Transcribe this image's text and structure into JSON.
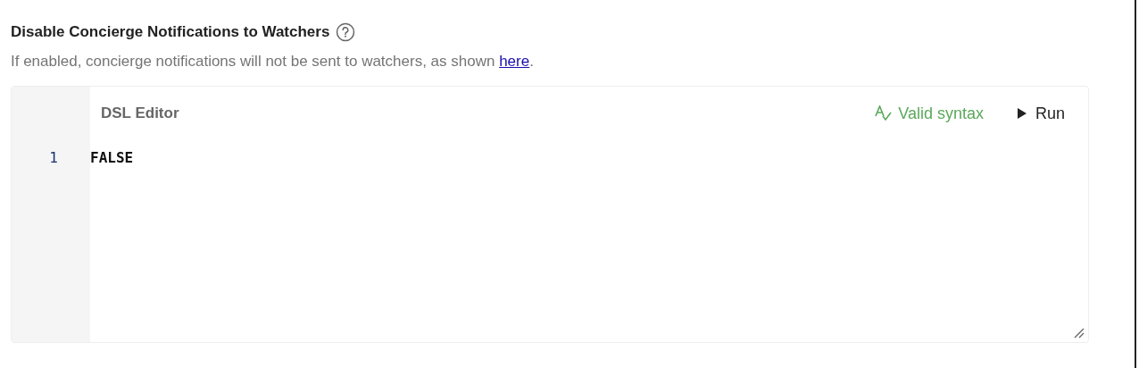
{
  "setting": {
    "title": "Disable Concierge Notifications to Watchers",
    "description_before": "If enabled, concierge notifications will not be sent to watchers, as shown ",
    "link": "here",
    "description_after": "."
  },
  "editor": {
    "title": "DSL Editor",
    "status": {
      "text": "Valid syntax",
      "valid": true
    },
    "run_label": "Run",
    "lines": [
      {
        "number": "1",
        "code": "FALSE"
      }
    ]
  }
}
